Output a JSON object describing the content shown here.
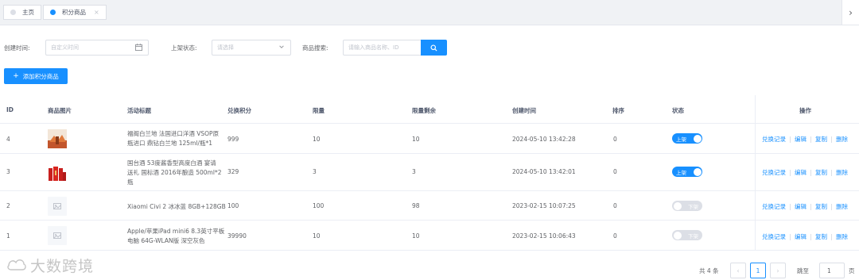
{
  "tabs": [
    {
      "label": "主页",
      "dot_color": "#dcdfe6"
    },
    {
      "label": "积分商品",
      "dot_color": "#1890ff",
      "close": "×"
    }
  ],
  "tab_next_icon": "chevron-right",
  "filters": {
    "created_label": "创建时间:",
    "created_placeholder": "自定义时间",
    "status_label": "上架状态:",
    "status_placeholder": "请选择",
    "search_label": "商品搜索:",
    "search_placeholder": "请输入商品名称、ID"
  },
  "add_button_label": "添加积分商品",
  "columns": [
    "ID",
    "商品图片",
    "活动标题",
    "兑换积分",
    "限量",
    "限量剩余",
    "创建时间",
    "排序",
    "状态",
    "操作"
  ],
  "rows": [
    {
      "id": "4",
      "title_line1": "福阁白兰地 法国进口洋酒 VSOP原",
      "title_line2": "瓶进口 鼎钻白兰地 125ml/瓶*1",
      "title_line3": "",
      "points": "999",
      "limit": "10",
      "remaining": "10",
      "created": "2024-05-10 13:42:28",
      "sort": "0",
      "status": "上架",
      "on": true
    },
    {
      "id": "3",
      "title_line1": "国台酒 53度酱香型高度白酒 宴请",
      "title_line2": "送礼 国标酒 2016年酿造 500ml*2",
      "title_line3": "瓶",
      "points": "329",
      "limit": "3",
      "remaining": "3",
      "created": "2024-05-10 13:42:01",
      "sort": "0",
      "status": "上架",
      "on": true
    },
    {
      "id": "2",
      "title_line1": "Xiaomi Civi 2 冰冰蓝 8GB+128GB",
      "title_line2": "",
      "title_line3": "",
      "points": "100",
      "limit": "100",
      "remaining": "98",
      "created": "2023-02-15 10:07:25",
      "sort": "0",
      "status": "下架",
      "on": false
    },
    {
      "id": "1",
      "title_line1": "Apple/苹果iPad mini6 8.3英寸平板",
      "title_line2": "电脑 64G-WLAN版 深空灰色",
      "title_line3": "",
      "points": "39990",
      "limit": "10",
      "remaining": "10",
      "created": "2023-02-15 10:06:43",
      "sort": "0",
      "status": "下架",
      "on": false
    }
  ],
  "row_actions": [
    "兑换记录",
    "编辑",
    "复制",
    "删除"
  ],
  "pagination": {
    "total": "共 4 条",
    "prev": "‹",
    "current": "1",
    "next": "›",
    "goto_label": "跳至",
    "goto_value": "1",
    "page_suffix": "页"
  },
  "watermark": "大数跨境",
  "colors": {
    "primary": "#1890ff",
    "switch_off": "#dcdfe6"
  }
}
